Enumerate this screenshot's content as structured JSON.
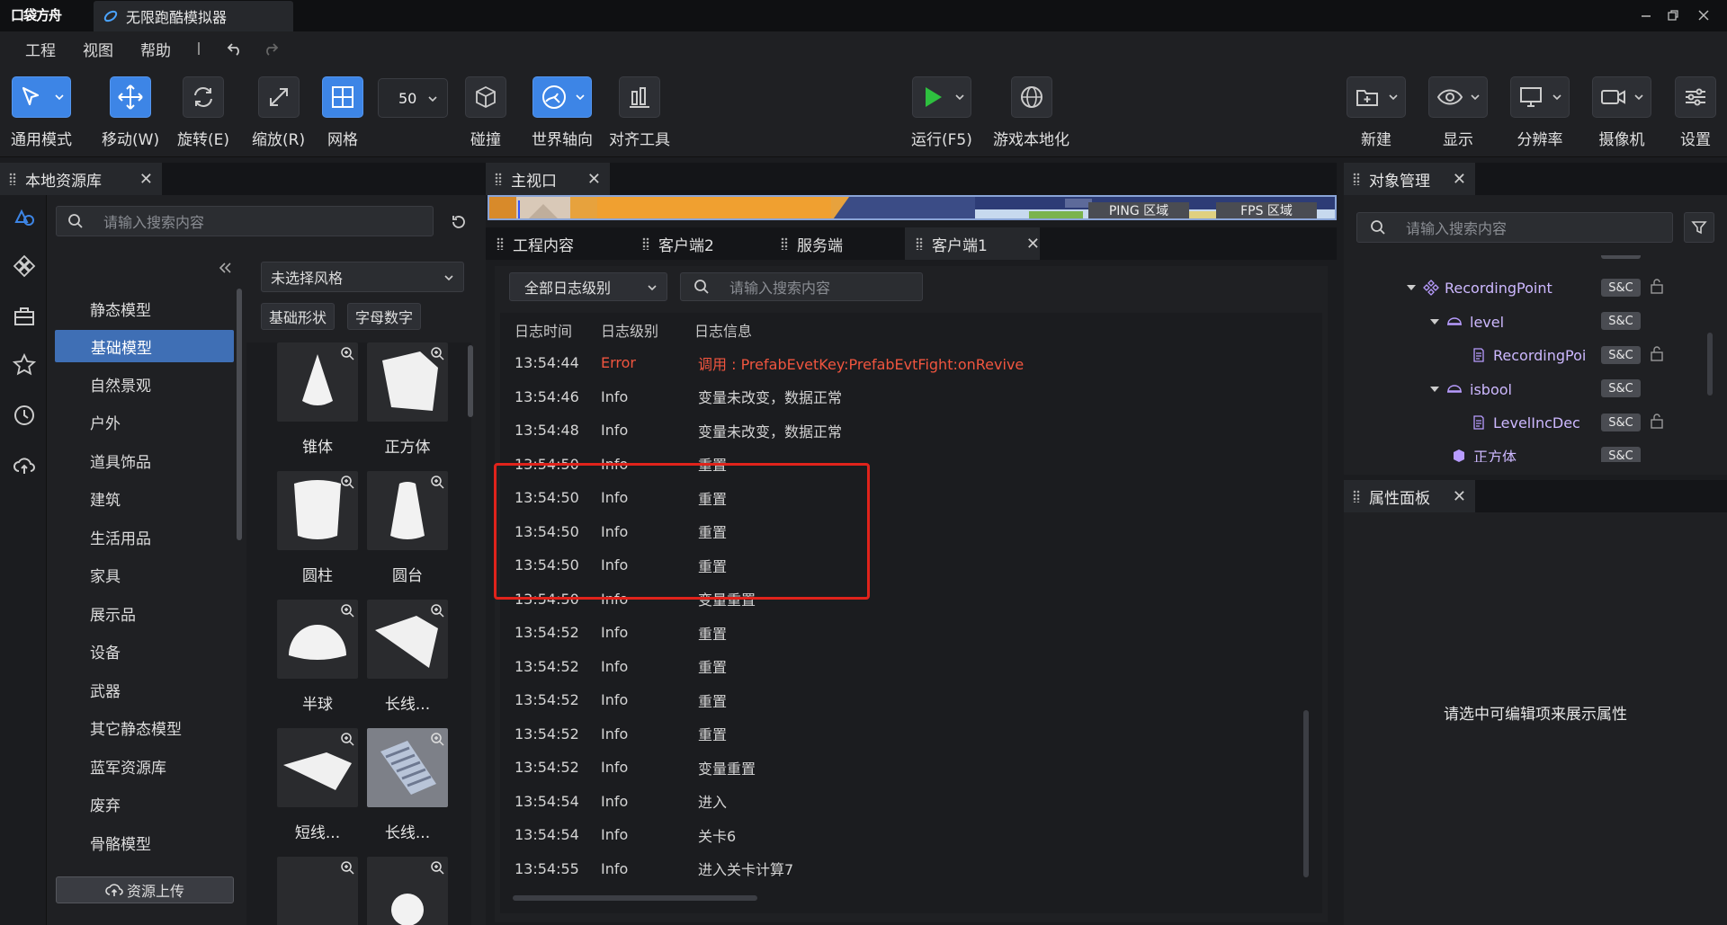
{
  "app": {
    "logo": "口袋方舟",
    "tab_title": "无限跑酷模拟器"
  },
  "menu": {
    "items": [
      "工程",
      "视图",
      "帮助"
    ]
  },
  "toolbar": {
    "general_mode": "通用模式",
    "move": "移动(W)",
    "rotate": "旋转(E)",
    "scale": "缩放(R)",
    "grid": "网格",
    "grid_size": "50",
    "collision": "碰撞",
    "world_axis": "世界轴向",
    "align": "对齐工具",
    "run": "运行(F5)",
    "localize": "游戏本地化",
    "new": "新建",
    "display": "显示",
    "resolution": "分辨率",
    "camera": "摄像机",
    "settings": "设置"
  },
  "left_panel": {
    "title": "本地资源库",
    "search_placeholder": "请输入搜索内容",
    "categories": {
      "group_static": "静态模型",
      "items": [
        "基础模型",
        "自然景观",
        "户外",
        "道具饰品",
        "建筑",
        "生活用品",
        "家具",
        "展示品",
        "设备",
        "武器",
        "其它静态模型",
        "蓝军资源库",
        "废弃"
      ],
      "group_skeleton": "骨骼模型"
    },
    "style_select": "未选择风格",
    "chips": [
      "基础形状",
      "字母数字"
    ],
    "assets": [
      "锥体",
      "正方体",
      "圆柱",
      "圆台",
      "半球",
      "长线...",
      "短线...",
      "长线..."
    ],
    "upload": "资源上传"
  },
  "viewport": {
    "title": "主视口",
    "ping": "PING 区域",
    "fps": "FPS 区域"
  },
  "sub_tabs": [
    "工程内容",
    "客户端2",
    "服务端",
    "客户端1"
  ],
  "log": {
    "level_select": "全部日志级别",
    "search_placeholder": "请输入搜索内容",
    "headers": {
      "time": "日志时间",
      "level": "日志级别",
      "message": "日志信息"
    },
    "rows": [
      {
        "time": "13:54:44",
        "level": "Error",
        "message": "调用 : PrefabEvetKey:PrefabEvtFight:onRevive"
      },
      {
        "time": "13:54:46",
        "level": "Info",
        "message": "变量未改变，数据正常"
      },
      {
        "time": "13:54:48",
        "level": "Info",
        "message": "变量未改变，数据正常"
      },
      {
        "time": "13:54:50",
        "level": "Info",
        "message": "重置"
      },
      {
        "time": "13:54:50",
        "level": "Info",
        "message": "重置"
      },
      {
        "time": "13:54:50",
        "level": "Info",
        "message": "重置"
      },
      {
        "time": "13:54:50",
        "level": "Info",
        "message": "重置"
      },
      {
        "time": "13:54:50",
        "level": "Info",
        "message": "变量重置"
      },
      {
        "time": "13:54:52",
        "level": "Info",
        "message": "重置"
      },
      {
        "time": "13:54:52",
        "level": "Info",
        "message": "重置"
      },
      {
        "time": "13:54:52",
        "level": "Info",
        "message": "重置"
      },
      {
        "time": "13:54:52",
        "level": "Info",
        "message": "重置"
      },
      {
        "time": "13:54:52",
        "level": "Info",
        "message": "变量重置"
      },
      {
        "time": "13:54:54",
        "level": "Info",
        "message": "进入"
      },
      {
        "time": "13:54:54",
        "level": "Info",
        "message": "关卡6"
      },
      {
        "time": "13:54:55",
        "level": "Info",
        "message": "进入关卡计算7"
      }
    ]
  },
  "object_panel": {
    "title": "对象管理",
    "search_placeholder": "请输入搜索内容",
    "badge": "S&C",
    "tree": [
      "RecordingPoint",
      "level",
      "RecordingPoi",
      "isbool",
      "LevelIncDec",
      "正方体"
    ]
  },
  "property_panel": {
    "title": "属性面板",
    "empty": "请选中可编辑项来展示属性"
  },
  "colors": {
    "accent": "#3d85e6",
    "error": "#f0553f",
    "highlight": "#e0231b",
    "tree_text": "#cdb8ff"
  }
}
